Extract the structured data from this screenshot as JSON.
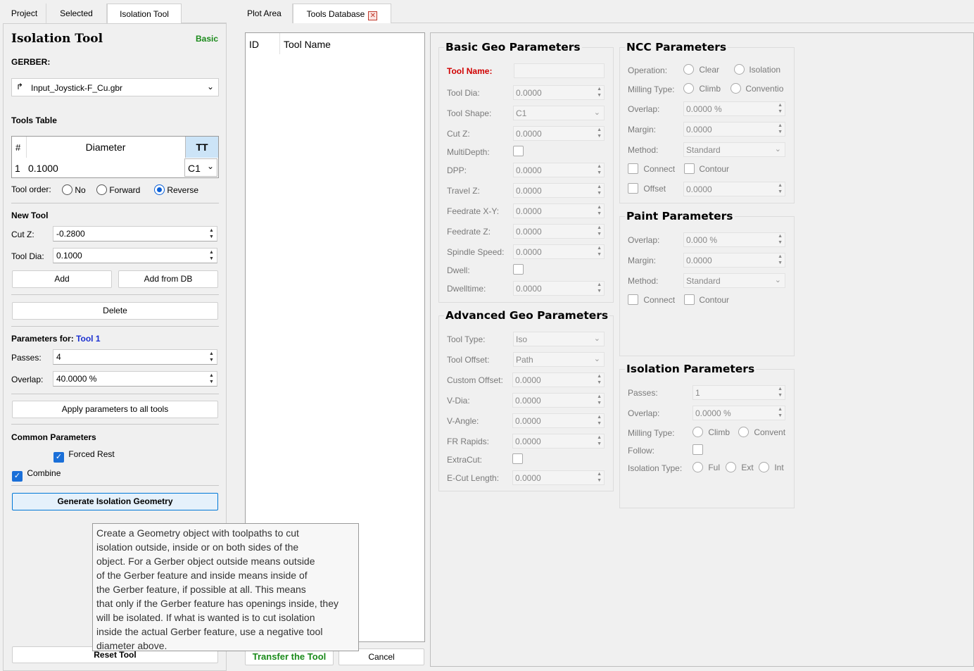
{
  "left_tabs": [
    "Project",
    "Selected",
    "Isolation Tool"
  ],
  "right_tabs": [
    "Plot Area",
    "Tools Database"
  ],
  "panel": {
    "title": "Isolation Tool",
    "mode": "Basic",
    "gerber_label": "GERBER:",
    "gerber_file": "Input_Joystick-F_Cu.gbr",
    "tools_table_label": "Tools Table",
    "table_headers": [
      "#",
      "Diameter",
      "TT"
    ],
    "table_rows": [
      {
        "num": "1",
        "diameter": "0.1000",
        "tt": "C1"
      }
    ],
    "tool_order_label": "Tool order:",
    "tool_order_options": [
      "No",
      "Forward",
      "Reverse"
    ],
    "new_tool_label": "New Tool",
    "cut_z_label": "Cut Z:",
    "cut_z_value": "-0.2800",
    "tool_dia_label": "Tool Dia:",
    "tool_dia_value": "0.1000",
    "add_btn": "Add",
    "add_db_btn": "Add from DB",
    "delete_btn": "Delete",
    "params_for_label": "Parameters for:",
    "params_for_tool": "Tool 1",
    "passes_label": "Passes:",
    "passes_value": "4",
    "overlap_label": "Overlap:",
    "overlap_value": "40.0000 %",
    "apply_btn": "Apply parameters to all tools",
    "common_label": "Common Parameters",
    "forced_rest": "Forced Rest",
    "combine": "Combine",
    "generate_btn": "Generate Isolation Geometry",
    "reset_btn": "Reset Tool"
  },
  "tooltip": "Create a Geometry object with toolpaths to cut\nisolation outside, inside or on both sides of the\nobject. For a Gerber object outside means outside\nof the Gerber feature and inside means inside of\nthe Gerber feature, if possible at all. This means\nthat only if the Gerber feature has openings inside, they\nwill be isolated. If what is wanted is to cut isolation\ninside the actual Gerber feature, use a negative tool\ndiameter above.",
  "db": {
    "headers": [
      "ID",
      "Tool Name"
    ],
    "transfer_btn": "Transfer the Tool",
    "cancel_btn": "Cancel"
  },
  "basic_geo": {
    "title": "Basic Geo Parameters",
    "tool_name": "Tool Name:",
    "tool_dia": {
      "label": "Tool Dia:",
      "value": "0.0000"
    },
    "tool_shape": {
      "label": "Tool Shape:",
      "value": "C1"
    },
    "cut_z": {
      "label": "Cut Z:",
      "value": "0.0000"
    },
    "multidepth": "MultiDepth:",
    "dpp": {
      "label": "DPP:",
      "value": "0.0000"
    },
    "travel_z": {
      "label": "Travel Z:",
      "value": "0.0000"
    },
    "feed_xy": {
      "label": "Feedrate X-Y:",
      "value": "0.0000"
    },
    "feed_z": {
      "label": "Feedrate Z:",
      "value": "0.0000"
    },
    "spindle": {
      "label": "Spindle Speed:",
      "value": "0.0000"
    },
    "dwell": "Dwell:",
    "dwelltime": {
      "label": "Dwelltime:",
      "value": "0.0000"
    }
  },
  "adv_geo": {
    "title": "Advanced Geo Parameters",
    "tool_type": {
      "label": "Tool Type:",
      "value": "Iso"
    },
    "tool_offset": {
      "label": "Tool Offset:",
      "value": "Path"
    },
    "custom_offset": {
      "label": "Custom Offset:",
      "value": "0.0000"
    },
    "vdia": {
      "label": "V-Dia:",
      "value": "0.0000"
    },
    "vangle": {
      "label": "V-Angle:",
      "value": "0.0000"
    },
    "fr_rapids": {
      "label": "FR Rapids:",
      "value": "0.0000"
    },
    "extracut": "ExtraCut:",
    "ecut_len": {
      "label": "E-Cut Length:",
      "value": "0.0000"
    }
  },
  "ncc": {
    "title": "NCC Parameters",
    "operation": "Operation:",
    "op_opts": [
      "Clear",
      "Isolation"
    ],
    "milling": "Milling Type:",
    "mill_opts": [
      "Climb",
      "Conventio"
    ],
    "overlap": {
      "label": "Overlap:",
      "value": "0.0000 %"
    },
    "margin": {
      "label": "Margin:",
      "value": "0.0000"
    },
    "method": {
      "label": "Method:",
      "value": "Standard"
    },
    "connect": "Connect",
    "contour": "Contour",
    "offset": {
      "label": "Offset",
      "value": "0.0000"
    }
  },
  "paint": {
    "title": "Paint Parameters",
    "overlap": {
      "label": "Overlap:",
      "value": "0.000 %"
    },
    "margin": {
      "label": "Margin:",
      "value": "0.0000"
    },
    "method": {
      "label": "Method:",
      "value": "Standard"
    },
    "connect": "Connect",
    "contour": "Contour"
  },
  "iso": {
    "title": "Isolation Parameters",
    "passes": {
      "label": "Passes:",
      "value": "1"
    },
    "overlap": {
      "label": "Overlap:",
      "value": "0.0000 %"
    },
    "milling": "Milling Type:",
    "mill_opts": [
      "Climb",
      "Convent"
    ],
    "follow": "Follow:",
    "iso_type": "Isolation Type:",
    "iso_opts": [
      "Ful",
      "Ext",
      "Int"
    ]
  }
}
